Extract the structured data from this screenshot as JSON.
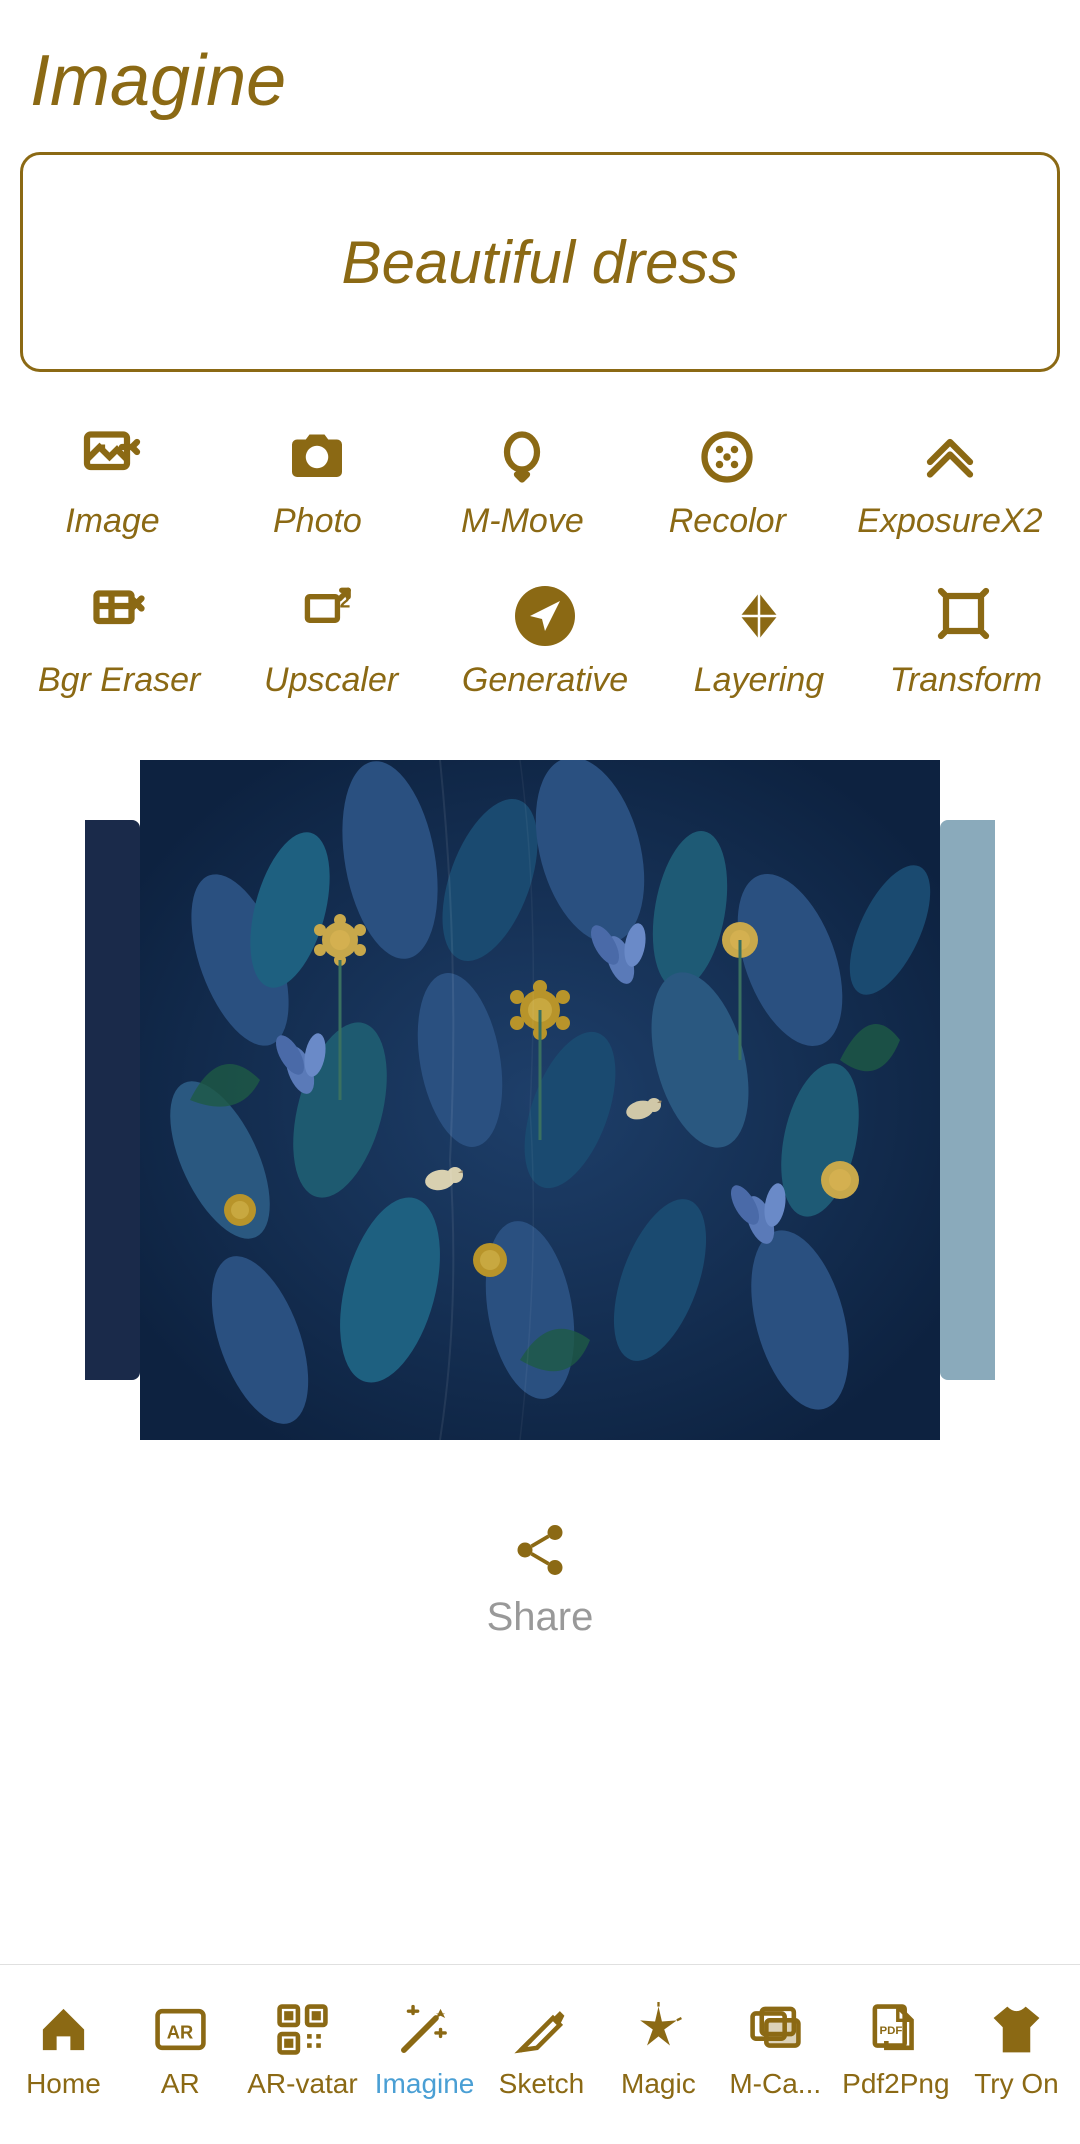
{
  "app": {
    "title": "Imagine"
  },
  "input": {
    "value": "Beautiful dress",
    "placeholder": "Beautiful dress"
  },
  "tools_row1": [
    {
      "id": "image",
      "label": "Image",
      "icon": "image-icon"
    },
    {
      "id": "photo",
      "label": "Photo",
      "icon": "camera-icon"
    },
    {
      "id": "mmove",
      "label": "M-Move",
      "icon": "balloon-icon"
    },
    {
      "id": "recolor",
      "label": "Recolor",
      "icon": "palette-icon"
    },
    {
      "id": "exposurex2",
      "label": "ExposureX2",
      "icon": "chevron-up-icon"
    }
  ],
  "tools_row2": [
    {
      "id": "bgr-eraser",
      "label": "Bgr Eraser",
      "icon": "bgr-eraser-icon"
    },
    {
      "id": "upscaler",
      "label": "Upscaler",
      "icon": "upscaler-icon"
    },
    {
      "id": "generative",
      "label": "Generative",
      "icon": "send-icon"
    },
    {
      "id": "layering",
      "label": "Layering",
      "icon": "diamond-icon"
    },
    {
      "id": "transform",
      "label": "Transform",
      "icon": "crop-icon"
    }
  ],
  "share": {
    "label": "Share",
    "icon": "share-icon"
  },
  "nav": {
    "items": [
      {
        "id": "home",
        "label": "Home",
        "icon": "home-icon",
        "active": false
      },
      {
        "id": "ar",
        "label": "AR",
        "icon": "ar-icon",
        "active": false
      },
      {
        "id": "ar-vatar",
        "label": "AR-vatar",
        "icon": "qr-icon",
        "active": false
      },
      {
        "id": "imagine",
        "label": "Imagine",
        "icon": "wand-icon",
        "active": true
      },
      {
        "id": "sketch",
        "label": "Sketch",
        "icon": "pencil-icon",
        "active": false
      },
      {
        "id": "magic",
        "label": "Magic",
        "icon": "magic-icon",
        "active": false
      },
      {
        "id": "mca",
        "label": "M-Ca...",
        "icon": "cards-icon",
        "active": false
      },
      {
        "id": "pdf2png",
        "label": "Pdf2Png",
        "icon": "pdf-icon",
        "active": false
      },
      {
        "id": "try-on",
        "label": "Try On",
        "icon": "shirt-icon",
        "active": false
      }
    ]
  }
}
